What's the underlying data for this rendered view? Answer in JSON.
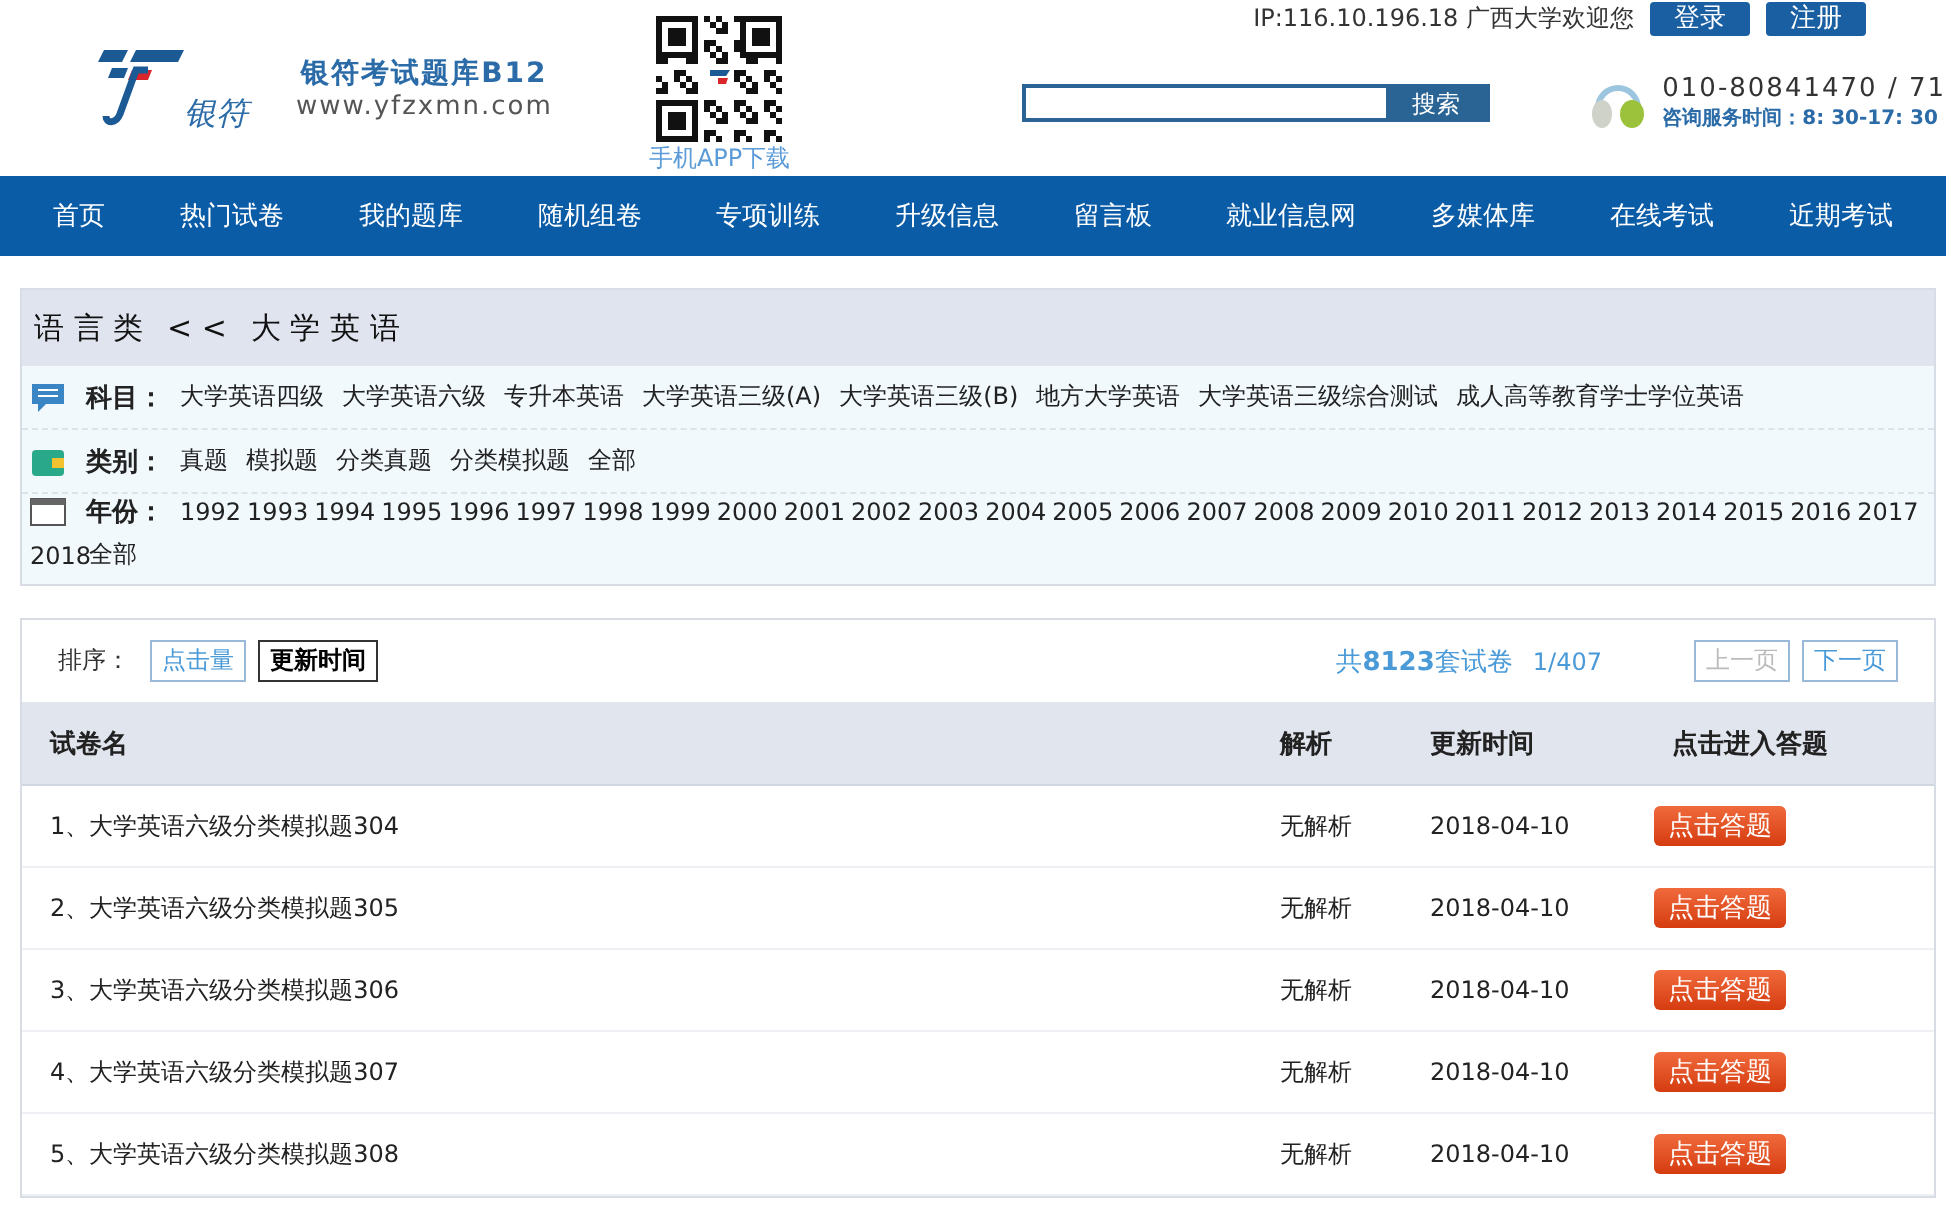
{
  "header": {
    "logo_text": "银符",
    "site_title": "银符考试题库B12",
    "site_url": "www.yfzxmn.com",
    "app_download": "手机APP下载",
    "ip_welcome": "IP:116.10.196.18 广西大学欢迎您",
    "login": "登录",
    "register": "注册",
    "search_button": "搜索",
    "phone": "010-80841470 / 71",
    "service_hours": "咨询服务时间：8: 30-17: 30"
  },
  "nav": [
    "首页",
    "热门试卷",
    "我的题库",
    "随机组卷",
    "专项训练",
    "升级信息",
    "留言板",
    "就业信息网",
    "多媒体库",
    "在线考试",
    "近期考试"
  ],
  "breadcrumb": {
    "parent": "语 言 类",
    "separator": "< <",
    "current": "大 学 英 语"
  },
  "filters": [
    {
      "kind": "subject",
      "label": "科目：",
      "items": [
        "大学英语四级",
        "大学英语六级",
        "专升本英语",
        "大学英语三级(A)",
        "大学英语三级(B)",
        "地方大学英语",
        "大学英语三级综合测试",
        "成人高等教育学士学位英语"
      ]
    },
    {
      "kind": "category",
      "label": "类别：",
      "items": [
        "真题",
        "模拟题",
        "分类真题",
        "分类模拟题",
        "全部"
      ]
    },
    {
      "kind": "year",
      "label": "年份：",
      "items": [
        "1992",
        "1993",
        "1994",
        "1995",
        "1996",
        "1997",
        "1998",
        "1999",
        "2000",
        "2001",
        "2002",
        "2003",
        "2004",
        "2005",
        "2006",
        "2007",
        "2008",
        "2009",
        "2010",
        "2011",
        "2012",
        "2013",
        "2014",
        "2015",
        "2016",
        "2017",
        "2018",
        "全部"
      ]
    }
  ],
  "sort": {
    "label": "排序：",
    "options": [
      {
        "label": "点击量",
        "selected": false
      },
      {
        "label": "更新时间",
        "selected": true
      }
    ]
  },
  "summary": {
    "total": "共**8123**套试卷",
    "page": "1/407"
  },
  "pagination": [
    {
      "label": "上一页",
      "disabled": true
    },
    {
      "label": "下一页",
      "disabled": false
    }
  ],
  "table": {
    "columns": [
      "试卷名",
      "解析",
      "更新时间",
      "点击进入答题"
    ],
    "rows": [
      {
        "name": "1、大学英语六级分类模拟题304",
        "analysis": "无解析",
        "date": "2018-04-10",
        "action": "点击答题"
      },
      {
        "name": "2、大学英语六级分类模拟题305",
        "analysis": "无解析",
        "date": "2018-04-10",
        "action": "点击答题"
      },
      {
        "name": "3、大学英语六级分类模拟题306",
        "analysis": "无解析",
        "date": "2018-04-10",
        "action": "点击答题"
      },
      {
        "name": "4、大学英语六级分类模拟题307",
        "analysis": "无解析",
        "date": "2018-04-10",
        "action": "点击答题"
      },
      {
        "name": "5、大学英语六级分类模拟题308",
        "analysis": "无解析",
        "date": "2018-04-10",
        "action": "点击答题"
      }
    ]
  }
}
